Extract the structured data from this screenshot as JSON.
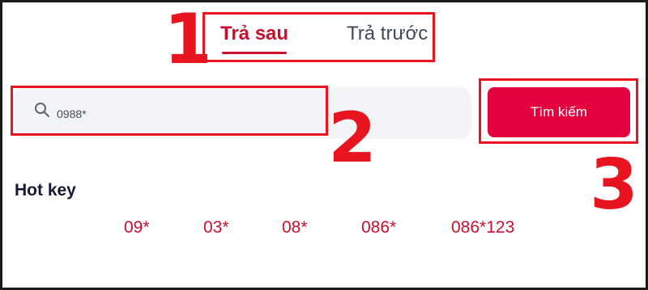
{
  "tabs": [
    {
      "label": "Trả sau",
      "active": true
    },
    {
      "label": "Trả trước",
      "active": false
    }
  ],
  "search": {
    "value": "0988*",
    "icon": "search-icon",
    "button_label": "Tìm kiếm"
  },
  "hotkeys": {
    "title": "Hot key",
    "items": [
      "09*",
      "03*",
      "08*",
      "086*",
      "086*123"
    ]
  },
  "annotations": [
    "1",
    "2",
    "3"
  ],
  "colors": {
    "accent": "#c8102e",
    "button": "#e4033f",
    "annotation": "#e8141f",
    "field_bg": "#f2f4f7"
  }
}
